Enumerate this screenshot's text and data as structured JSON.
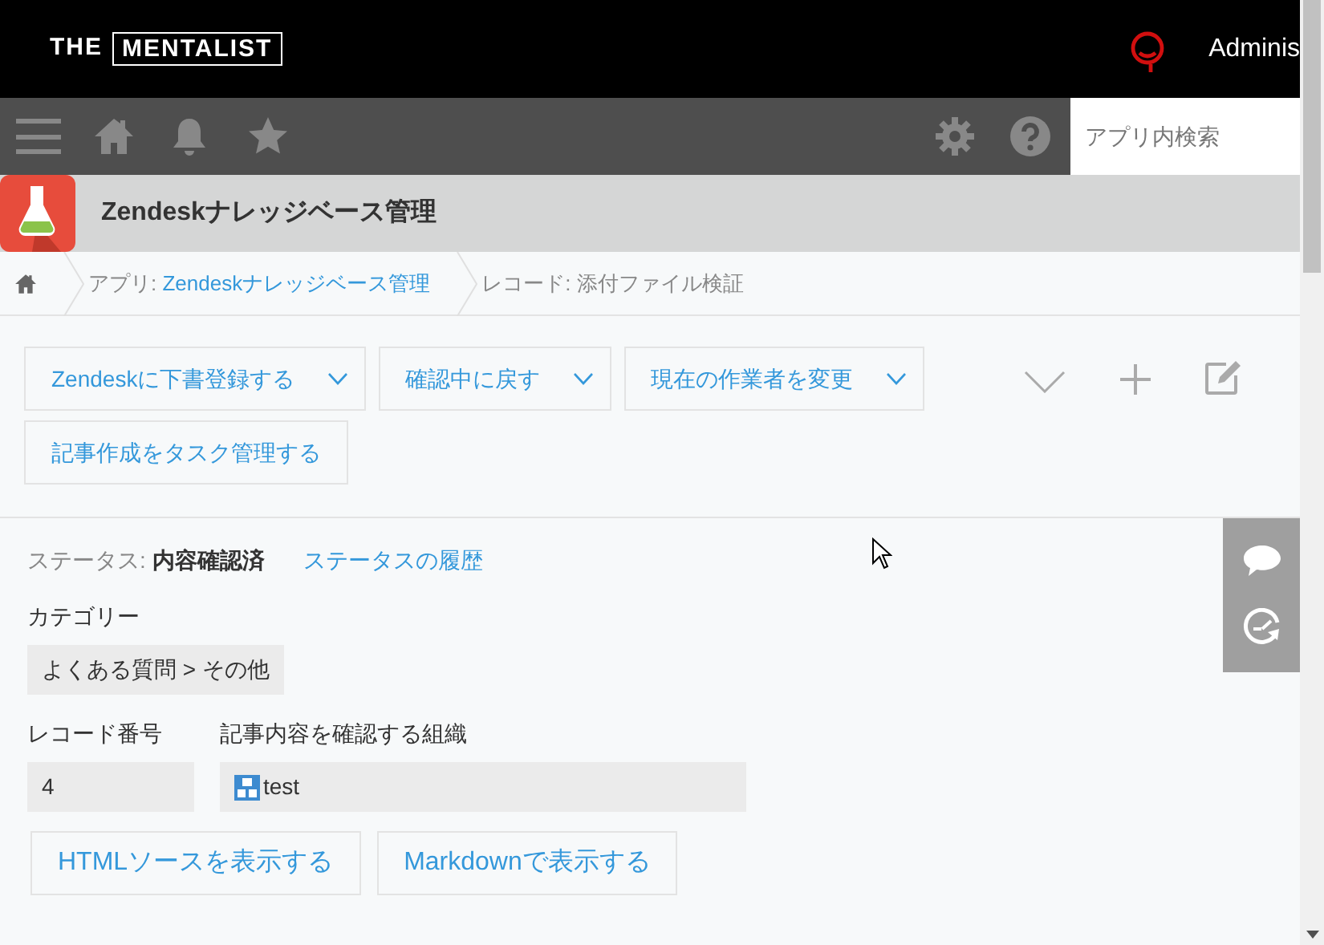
{
  "header": {
    "logo": [
      "THE",
      "MENTALIST"
    ],
    "user": "Adminis"
  },
  "toolbar": {
    "search": {
      "placeholder": "アプリ内検索"
    }
  },
  "app": {
    "title": "Zendeskナレッジベース管理"
  },
  "breadcrumb": [
    {
      "prefix": "アプリ: ",
      "text": "Zendeskナレッジベース管理",
      "kind": "link"
    },
    {
      "prefix": "レコード: ",
      "text": "添付ファイル検証",
      "kind": "plain"
    }
  ],
  "actions": [
    {
      "label": "Zendeskに下書登録する",
      "dropdown": true
    },
    {
      "label": "確認中に戻す",
      "dropdown": true
    },
    {
      "label": "現在の作業者を変更",
      "dropdown": true
    },
    {
      "label": "記事作成をタスク管理する",
      "dropdown": false
    }
  ],
  "status": {
    "label": "ステータス:",
    "value": "内容確認済",
    "history_link": "ステータスの履歴"
  },
  "field_rows": [
    [
      {
        "label": "カテゴリー",
        "value": "よくある質問 > その他",
        "kind": "text"
      }
    ],
    [
      {
        "label": "レコード番号",
        "value": "4",
        "kind": "text"
      },
      {
        "label": "記事内容を確認する組織",
        "value": "test",
        "kind": "org"
      }
    ]
  ],
  "buttons": [
    "HTMLソースを表示する",
    "Markdownで表示する"
  ]
}
